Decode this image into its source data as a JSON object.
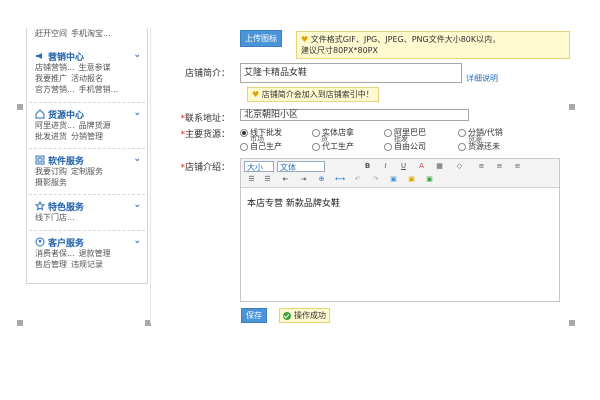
{
  "sidebar": {
    "top_line": [
      "赶开空间",
      "手机淘宝..."
    ],
    "groups": [
      {
        "title": "营销中心",
        "icon": "megaphone-icon",
        "lines": [
          [
            "店铺营销...",
            "生意参谋"
          ],
          [
            "我要推广",
            "活动报名"
          ],
          [
            "官方营销...",
            "手机营销..."
          ]
        ]
      },
      {
        "title": "货源中心",
        "icon": "house-icon",
        "lines": [
          [
            "阿里进货...",
            "品牌货源"
          ],
          [
            "批发进货",
            "分销管理"
          ]
        ]
      },
      {
        "title": "软件服务",
        "icon": "grid-icon",
        "lines": [
          [
            "我要订购",
            "定制服务"
          ],
          [
            "摄影服务",
            ""
          ]
        ]
      },
      {
        "title": "特色服务",
        "icon": "star-icon",
        "lines": [
          [
            "线下门店...",
            ""
          ]
        ]
      },
      {
        "title": "客户服务",
        "icon": "person-icon",
        "lines": [
          [
            "消费者保...",
            "退款管理"
          ],
          [
            "售后管理",
            "违规记录"
          ]
        ]
      }
    ]
  },
  "form": {
    "upload_button": "上传图标",
    "upload_tip_1": "文件格式GIF、JPG、JPEG、PNG文件大小80K以内，",
    "upload_tip_2": "建议尺寸80PX*80PX",
    "intro_label": "店铺简介：",
    "intro_value": "艾隆卡精品女鞋",
    "detail_link": "详细说明",
    "intro_tip": "店铺简介会加入到店铺索引中！",
    "address_label": "联系地址：",
    "address_value": "北京朝阳小区",
    "source_label": "主要货源：",
    "source_options": [
      "线下批发",
      "实体店拿",
      "阿里巴巴",
      "分销/代销",
      "自己生产",
      "代工生产",
      "自由公司",
      "货源还未"
    ],
    "source_extra": [
      "市场",
      "货",
      "批发",
      "货源"
    ],
    "desc_label": "店铺介绍：",
    "font_size": "大小",
    "font_family": "文体",
    "editor_content": "本店专营  新款品牌女鞋",
    "save_button": "保存",
    "success_msg": "操作成功",
    "required_mark": "*"
  },
  "colors": {
    "accent": "#4a95d8",
    "link": "#2a6ebd",
    "required": "#e02020",
    "tip_bg": "#fff9cf"
  }
}
